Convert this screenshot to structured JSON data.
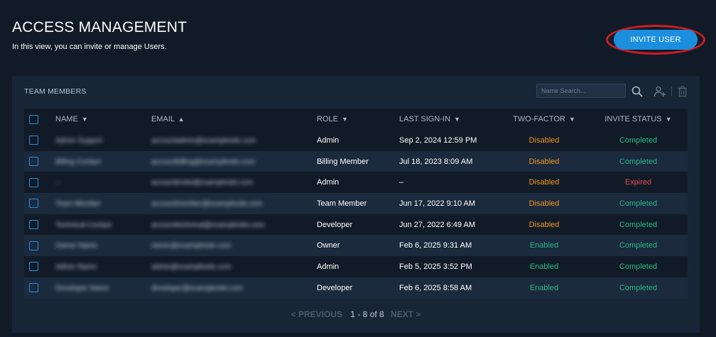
{
  "header": {
    "title": "ACCESS MANAGEMENT",
    "subtitle": "In this view, you can invite or manage Users.",
    "invite_label": "INVITE USER",
    "highlight_color": "#cf1c25",
    "accent_color": "#1b8fde"
  },
  "panel": {
    "title": "TEAM MEMBERS",
    "search_placeholder": "Name Search...",
    "icons": [
      "search-icon",
      "add-user-icon",
      "trash-icon"
    ]
  },
  "table": {
    "columns": {
      "name": "NAME",
      "email": "EMAIL",
      "role": "ROLE",
      "last_sign_in": "LAST SIGN-IN",
      "two_factor": "TWO-FACTOR",
      "invite_status": "INVITE STATUS"
    },
    "sort_arrows": {
      "name": "▼",
      "email": "▲",
      "role": "▼",
      "last_sign_in": "▼",
      "two_factor": "▼",
      "invite_status": "▼"
    },
    "rows": [
      {
        "name": "Admin Support",
        "email": "accountadmin@examplesite.com",
        "role": "Admin",
        "last_sign_in": "Sep 2, 2024 12:59 PM",
        "two_factor": "Disabled",
        "invite_status": "Completed"
      },
      {
        "name": "Billing Contact",
        "email": "accountbilling@examplesite.com",
        "role": "Billing Member",
        "last_sign_in": "Jul 18, 2023 8:09 AM",
        "two_factor": "Disabled",
        "invite_status": "Completed"
      },
      {
        "name": "--",
        "email": "accountinvite@examplesite.com",
        "role": "Admin",
        "last_sign_in": "–",
        "two_factor": "Disabled",
        "invite_status": "Expired"
      },
      {
        "name": "Team Member",
        "email": "accountmember@examplesite.com",
        "role": "Team Member",
        "last_sign_in": "Jun 17, 2022 9:10 AM",
        "two_factor": "Disabled",
        "invite_status": "Completed"
      },
      {
        "name": "Technical Contact",
        "email": "accounttechnical@examplesite.com",
        "role": "Developer",
        "last_sign_in": "Jun 27, 2022 6:49 AM",
        "two_factor": "Disabled",
        "invite_status": "Completed"
      },
      {
        "name": "Owner Name",
        "email": "owner@examplesite.com",
        "role": "Owner",
        "last_sign_in": "Feb 6, 2025 9:31 AM",
        "two_factor": "Enabled",
        "invite_status": "Completed"
      },
      {
        "name": "Admin Name",
        "email": "admin@examplesite.com",
        "role": "Admin",
        "last_sign_in": "Feb 5, 2025 3:52 PM",
        "two_factor": "Enabled",
        "invite_status": "Completed"
      },
      {
        "name": "Developer Name",
        "email": "developer@examplesite.com",
        "role": "Developer",
        "last_sign_in": "Feb 6, 2025 8:58 AM",
        "two_factor": "Enabled",
        "invite_status": "Completed"
      }
    ]
  },
  "pagination": {
    "prev_label": "< PREVIOUS",
    "range": "1 - 8 of 8",
    "next_label": "NEXT >"
  },
  "status_colors": {
    "disabled": "#f3951f",
    "enabled": "#27b787",
    "completed": "#27b787",
    "expired": "#e5454f"
  }
}
